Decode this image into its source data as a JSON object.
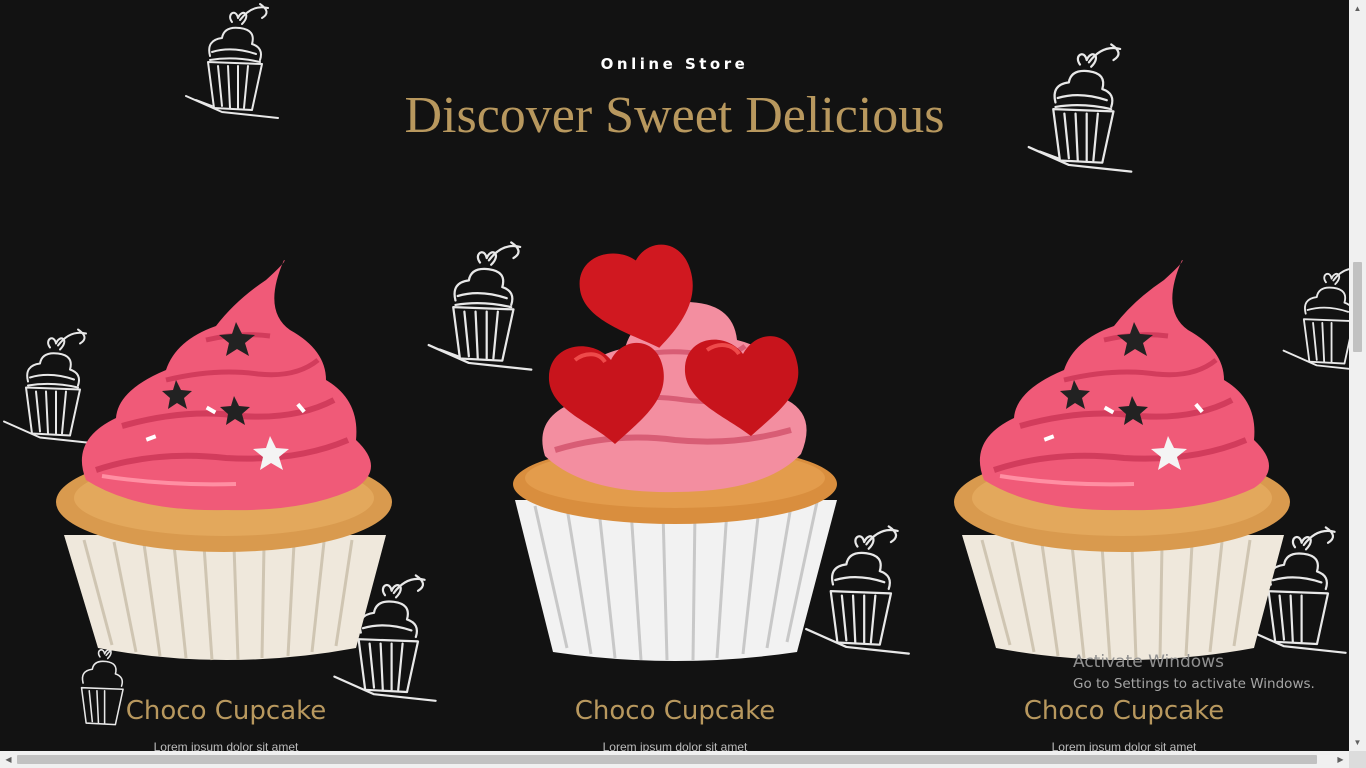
{
  "hero": {
    "eyebrow": "Online Store",
    "title": "Discover Sweet Delicious"
  },
  "products": [
    {
      "name": "Choco Cupcake",
      "description": "Lorem ipsum dolor sit amet",
      "style": "pink-swirl"
    },
    {
      "name": "Choco Cupcake",
      "description": "Lorem ipsum dolor sit amet",
      "style": "hearts"
    },
    {
      "name": "Choco Cupcake",
      "description": "Lorem ipsum dolor sit amet",
      "style": "pink-swirl"
    }
  ],
  "watermark": {
    "line1": "Activate Windows",
    "line2": "Go to Settings to activate Windows."
  },
  "colors": {
    "background": "#121212",
    "accent_gold": "#b8985e",
    "frosting_pink": "#f05a78",
    "heart_red": "#d01820",
    "cake_orange": "#d99a4e",
    "liner_white": "#efe8dc"
  },
  "icons": {
    "doodle": "cupcake-sketch-icon",
    "scroll_up": "up-arrow-icon",
    "scroll_down": "down-arrow-icon",
    "scroll_left": "left-arrow-icon",
    "scroll_right": "right-arrow-icon"
  }
}
